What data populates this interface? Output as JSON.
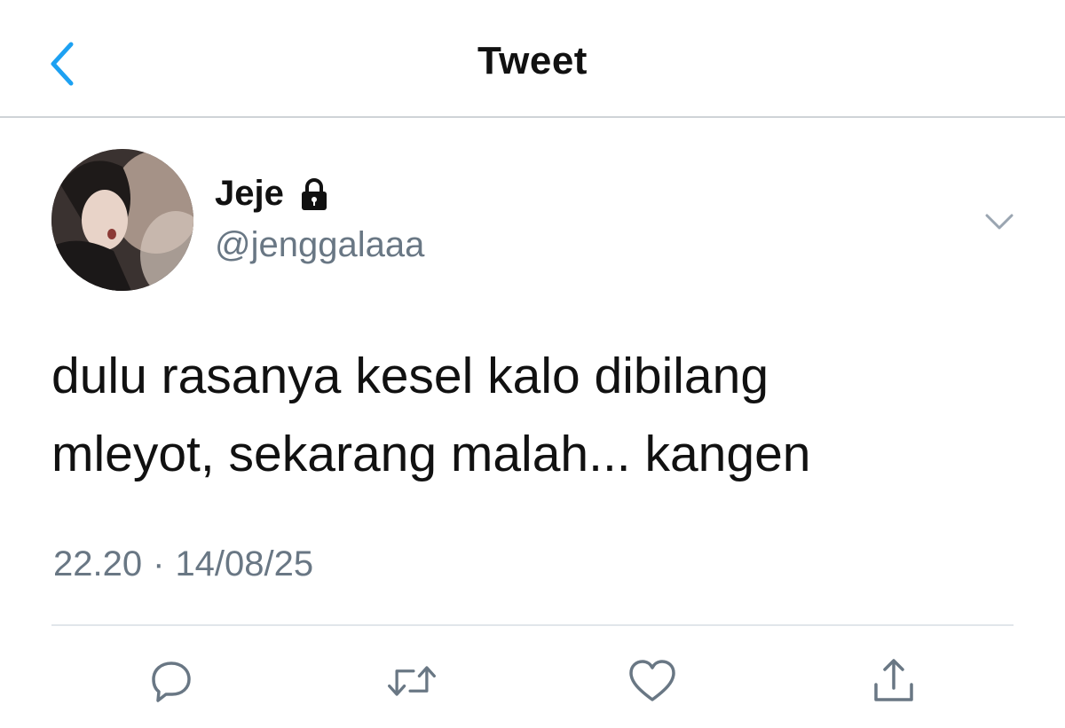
{
  "header": {
    "title": "Tweet",
    "back_icon": "chevron-left-icon"
  },
  "colors": {
    "accent": "#1da1f2",
    "secondary_text": "#697784",
    "divider": "#e1e6ea"
  },
  "author": {
    "display_name": "Jeje",
    "handle": "@jenggalaaa",
    "protected_icon": "lock-icon"
  },
  "tweet": {
    "lines": [
      "dulu rasanya kesel kalo dibilang",
      "mleyot, sekarang malah... kangen"
    ],
    "time": "22.20",
    "separator": "·",
    "date": "14/08/25"
  },
  "actions": [
    {
      "name": "reply",
      "icon": "comment-icon"
    },
    {
      "name": "retweet",
      "icon": "retweet-icon"
    },
    {
      "name": "like",
      "icon": "heart-icon"
    },
    {
      "name": "share",
      "icon": "share-icon"
    }
  ]
}
